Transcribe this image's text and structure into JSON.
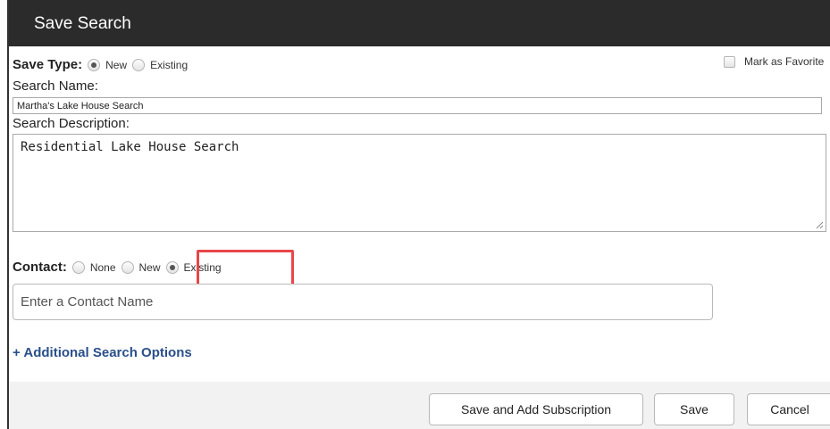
{
  "dialog": {
    "title": "Save Search"
  },
  "save_type": {
    "label": "Save Type:",
    "options": [
      {
        "label": "New",
        "checked": true
      },
      {
        "label": "Existing",
        "checked": false
      }
    ]
  },
  "favorite": {
    "label": "Mark as Favorite",
    "checked": false
  },
  "search_name": {
    "label": "Search Name:",
    "value": "Martha's Lake House Search"
  },
  "search_description": {
    "label": "Search Description:",
    "value": "Residential Lake House Search"
  },
  "contact": {
    "label": "Contact:",
    "options": [
      {
        "label": "None",
        "checked": false
      },
      {
        "label": "New",
        "checked": false
      },
      {
        "label": "Existing",
        "checked": true
      }
    ],
    "input_placeholder": "Enter a Contact Name"
  },
  "additional_options_link": "+ Additional Search Options",
  "footer": {
    "save_and_add_subscription": "Save and Add Subscription",
    "save": "Save",
    "cancel": "Cancel"
  },
  "colors": {
    "titlebar": "#2b2b2b",
    "link": "#2a4f8a",
    "highlight": "#e8454a"
  }
}
